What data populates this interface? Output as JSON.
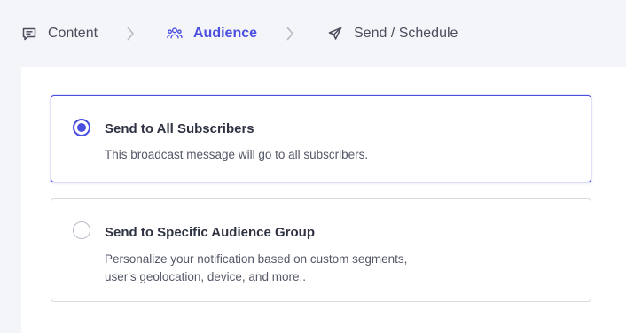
{
  "stepper": {
    "steps": [
      {
        "label": "Content",
        "icon": "message-square-icon",
        "active": false
      },
      {
        "label": "Audience",
        "icon": "users-icon",
        "active": true
      },
      {
        "label": "Send / Schedule",
        "icon": "send-icon",
        "active": false
      }
    ],
    "separator_icon": "chevron-right-icon"
  },
  "options": [
    {
      "title": "Send to All Subscribers",
      "description": "This broadcast message will go to all subscribers.",
      "selected": true
    },
    {
      "title": "Send to Specific Audience Group",
      "description_line1": "Personalize your notification based on custom segments,",
      "description_line2": "user's geolocation, device, and more..",
      "selected": false
    }
  ],
  "colors": {
    "accent": "#4b4fe0",
    "background": "#f4f5f9",
    "card_border": "#d9dbe3"
  }
}
